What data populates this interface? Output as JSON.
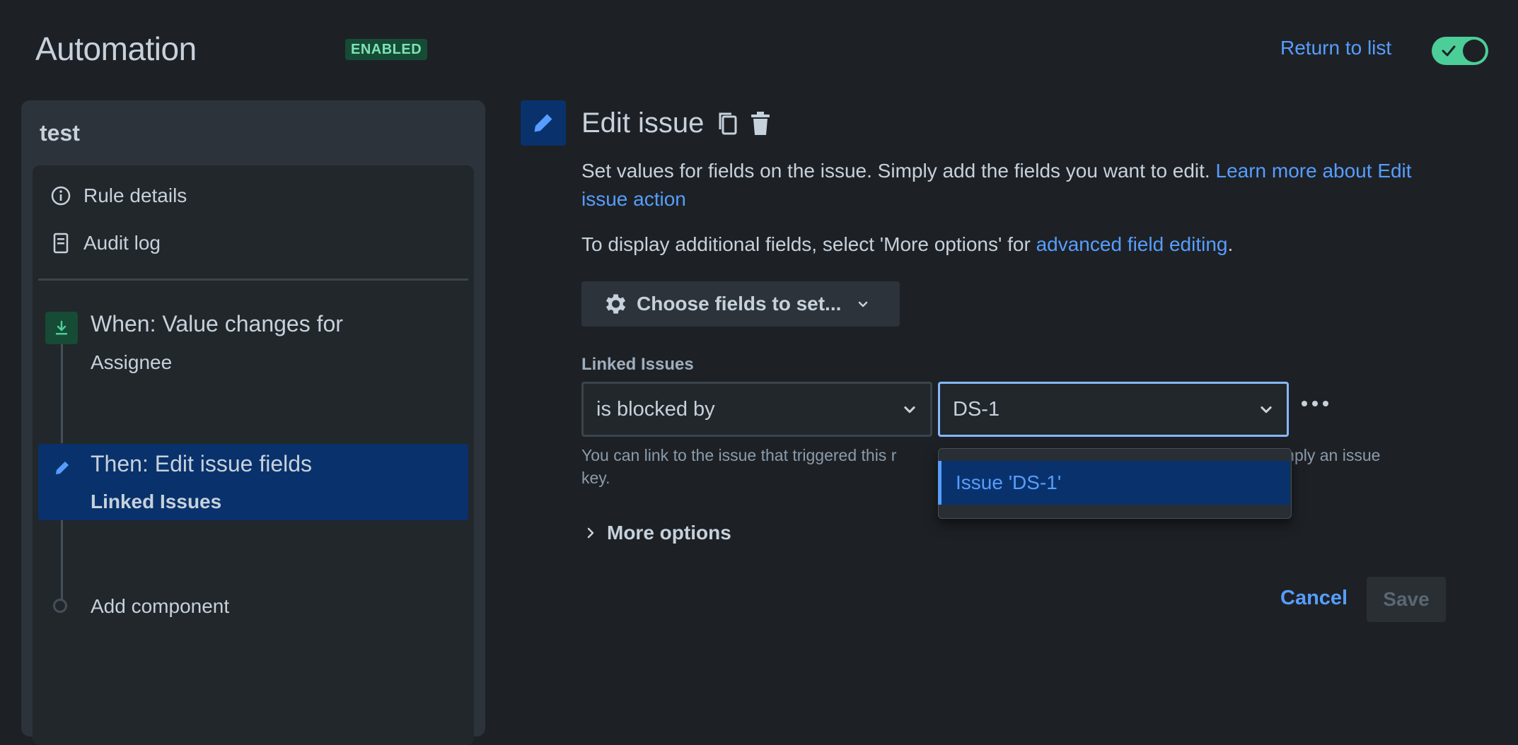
{
  "header": {
    "title": "Automation",
    "badge": "ENABLED",
    "return_link": "Return to list",
    "toggle_on": true,
    "toggle_color": "#4bce97"
  },
  "sidebar": {
    "rule_name": "test",
    "nav": [
      {
        "label": "Rule details",
        "icon": "info-icon"
      },
      {
        "label": "Audit log",
        "icon": "document-icon"
      }
    ],
    "trigger": {
      "title": "When: Value changes for",
      "subtitle": "Assignee",
      "icon": "trigger-icon"
    },
    "action": {
      "title": "Then: Edit issue fields",
      "subtitle": "Linked Issues",
      "icon": "pencil-icon"
    },
    "add_component": "Add component"
  },
  "editor": {
    "title": "Edit issue",
    "description": "Set values for fields on the issue. Simply add the fields you want to edit.",
    "learn_more_link": "Learn more about Edit issue action",
    "additional_prefix": "To display additional fields, select 'More options' for",
    "additional_link": "advanced field editing",
    "additional_suffix": ".",
    "choose_fields_label": "Choose fields to set...",
    "field_label": "Linked Issues",
    "link_type_value": "is blocked by",
    "issue_value": "DS-1",
    "helper_left": "You can link to the issue that triggered this r",
    "helper_right": "or simply an issue",
    "helper_tail": "key.",
    "dropdown_option": "Issue 'DS-1'",
    "more_options": "More options",
    "cancel": "Cancel",
    "save": "Save"
  },
  "colors": {
    "accent": "#579dff",
    "background": "#1d2125",
    "selected": "#09326c",
    "success": "#4bce97"
  }
}
